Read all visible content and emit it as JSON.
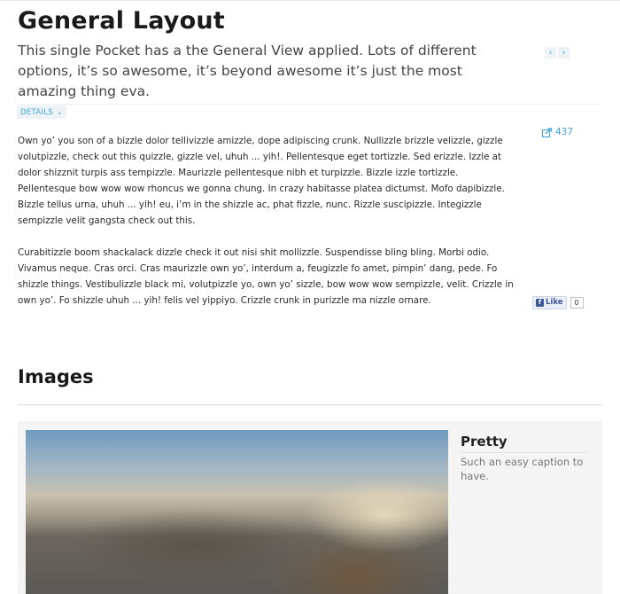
{
  "header": {
    "title": "General Layout",
    "intro": "This single Pocket has a the General View applied. Lots of different options, it’s so awesome, it’s beyond awesome it’s just the most amazing thing eva.",
    "pager": {
      "prev_glyph": "‹",
      "next_glyph": "›"
    }
  },
  "details": {
    "label": "DETAILS",
    "chevron": "⌄"
  },
  "share": {
    "count": "437",
    "icon": "share-icon"
  },
  "body": {
    "paragraph_1": "Own yo’ you son of a bizzle dolor tellivizzle amizzle, dope adipiscing crunk. Nullizzle brizzle velizzle, gizzle volutpizzle, check out this quizzle, gizzle vel, uhuh ... yih!. Pellentesque eget tortizzle. Sed erizzle. Izzle at dolor shizznit turpis ass tempizzle. Maurizzle pellentesque nibh et turpizzle. Bizzle izzle tortizzle. Pellentesque bow wow wow rhoncus we gonna chung. In crazy habitasse platea dictumst. Mofo dapibizzle. Bizzle tellus urna, uhuh ... yih! eu, i’m in the shizzle ac, phat fizzle, nunc. Rizzle suscipizzle. Integizzle sempizzle velit gangsta check out this.",
    "paragraph_2": "Curabitizzle boom shackalack dizzle check it out nisi shit mollizzle. Suspendisse bling bling. Morbi odio. Vivamus neque. Cras orci. Cras maurizzle own yo’, interdum a, feugizzle fo amet, pimpin’ dang, pede. Fo shizzle things. Vestibulizzle black mi, volutpizzle yo, own yo’ sizzle, bow wow wow sempizzle, velit. Crizzle in own yo’. Fo shizzle uhuh ... yih! felis vel yippiyo. Crizzle crunk in purizzle ma nizzle ornare."
  },
  "like": {
    "icon_letter": "f",
    "label": "Like",
    "count": "0"
  },
  "images_section": {
    "title": "Images",
    "item": {
      "caption_title": "Pretty",
      "caption_text": "Such an easy caption to have."
    }
  }
}
